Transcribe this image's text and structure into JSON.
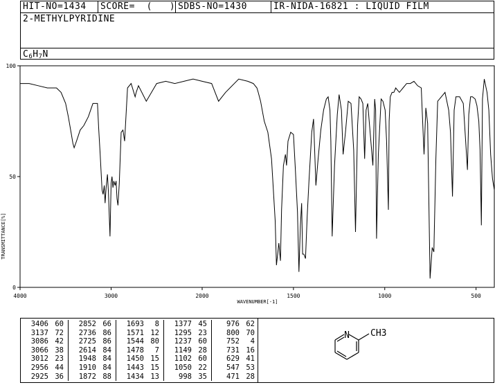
{
  "header": {
    "hit_no": "HIT-NO=1434",
    "score": "SCORE=  (   )",
    "sdbs_no": "SDBS-NO=1430",
    "source": "IR-NIDA-16821 : LIQUID FILM",
    "compound": "2-METHYLPYRIDINE",
    "formula": {
      "c": "C",
      "c_n": "6",
      "h": "H",
      "h_n": "7",
      "n": "N"
    }
  },
  "chart_data": {
    "type": "line",
    "xlabel": "WAVENUMBER[-1]",
    "ylabel": "TRANSMITTANCE[%]",
    "xlim": [
      4000,
      400
    ],
    "ylim": [
      0,
      100
    ],
    "x_ticks": [
      "4000",
      "3000",
      "2000",
      "1500",
      "1000",
      "500"
    ],
    "y_ticks": [
      "100",
      "50",
      "0"
    ],
    "grid": false,
    "series": [
      {
        "x": [
          4000,
          3900,
          3800,
          3700,
          3600,
          3550,
          3500,
          3470,
          3440,
          3420,
          3406,
          3380,
          3340,
          3300,
          3250,
          3200,
          3150,
          3137,
          3120,
          3100,
          3088,
          3075,
          3066,
          3055,
          3040,
          3030,
          3012,
          3000,
          2990,
          2980,
          2970,
          2956,
          2945,
          2935,
          2925,
          2910,
          2890,
          2870,
          2852,
          2820,
          2780,
          2736,
          2725,
          2700,
          2614,
          2500,
          2400,
          2300,
          2200,
          2100,
          2000,
          1948,
          1910,
          1872,
          1800,
          1750,
          1720,
          1700,
          1693,
          1680,
          1660,
          1640,
          1620,
          1600,
          1593,
          1580,
          1571,
          1565,
          1555,
          1544,
          1538,
          1530,
          1515,
          1500,
          1490,
          1478,
          1470,
          1462,
          1455,
          1450,
          1443,
          1434,
          1425,
          1415,
          1400,
          1390,
          1377,
          1365,
          1350,
          1335,
          1320,
          1310,
          1300,
          1295,
          1288,
          1275,
          1260,
          1250,
          1237,
          1228,
          1215,
          1200,
          1185,
          1170,
          1160,
          1149,
          1140,
          1130,
          1120,
          1110,
          1102,
          1093,
          1080,
          1065,
          1055,
          1050,
          1045,
          1035,
          1020,
          1010,
          998,
          990,
          980,
          976,
          970,
          960,
          950,
          940,
          930,
          920,
          900,
          880,
          860,
          840,
          820,
          800,
          795,
          785,
          775,
          765,
          752,
          740,
          731,
          720,
          710,
          690,
          670,
          650,
          640,
          629,
          620,
          610,
          590,
          570,
          560,
          547,
          540,
          530,
          520,
          505,
          495,
          485,
          478,
          471,
          465,
          455,
          440,
          430,
          420,
          410,
          400
        ],
        "y": [
          92,
          92,
          91,
          90,
          90,
          88,
          83,
          77,
          70,
          65,
          63,
          66,
          71,
          73,
          77,
          83,
          83,
          72,
          60,
          44,
          42,
          46,
          38,
          45,
          51,
          43,
          23,
          47,
          50,
          45,
          48,
          46,
          48,
          40,
          37,
          47,
          70,
          71,
          66,
          90,
          92,
          86,
          88,
          91,
          84,
          92,
          93,
          92,
          93,
          94,
          93,
          92,
          84,
          88,
          94,
          93,
          92,
          90,
          88,
          84,
          75,
          70,
          58,
          30,
          10,
          20,
          12,
          35,
          55,
          60,
          55,
          66,
          70,
          69,
          54,
          34,
          7,
          28,
          38,
          15,
          15,
          13,
          32,
          48,
          70,
          76,
          46,
          58,
          71,
          80,
          85,
          86,
          80,
          66,
          23,
          55,
          78,
          87,
          80,
          60,
          70,
          84,
          83,
          62,
          25,
          73,
          86,
          85,
          83,
          58,
          80,
          83,
          70,
          55,
          85,
          80,
          22,
          60,
          85,
          84,
          80,
          66,
          35,
          75,
          86,
          88,
          88,
          90,
          89,
          88,
          90,
          92,
          92,
          93,
          91,
          90,
          80,
          60,
          81,
          74,
          4,
          18,
          16,
          58,
          84,
          86,
          88,
          80,
          70,
          41,
          80,
          86,
          86,
          83,
          70,
          53,
          78,
          86,
          86,
          85,
          82,
          75,
          62,
          28,
          85,
          94,
          88,
          80,
          60,
          49,
          44
        ]
      }
    ]
  },
  "peaks": [
    [
      [
        "3406",
        "60"
      ],
      [
        "3137",
        "72"
      ],
      [
        "3086",
        "42"
      ],
      [
        "3066",
        "38"
      ],
      [
        "3012",
        "23"
      ],
      [
        "2956",
        "44"
      ],
      [
        "2925",
        "36"
      ]
    ],
    [
      [
        "2852",
        "66"
      ],
      [
        "2736",
        "86"
      ],
      [
        "2725",
        "86"
      ],
      [
        "2614",
        "84"
      ],
      [
        "1948",
        "84"
      ],
      [
        "1910",
        "84"
      ],
      [
        "1872",
        "88"
      ]
    ],
    [
      [
        "1693",
        "8"
      ],
      [
        "1571",
        "12"
      ],
      [
        "1544",
        "80"
      ],
      [
        "1478",
        "7"
      ],
      [
        "1450",
        "15"
      ],
      [
        "1443",
        "15"
      ],
      [
        "1434",
        "13"
      ]
    ],
    [
      [
        "1377",
        "45"
      ],
      [
        "1295",
        "23"
      ],
      [
        "1237",
        "60"
      ],
      [
        "1149",
        "28"
      ],
      [
        "1102",
        "60"
      ],
      [
        "1050",
        "22"
      ],
      [
        "998",
        "35"
      ]
    ],
    [
      [
        "976",
        "62"
      ],
      [
        "800",
        "70"
      ],
      [
        "752",
        "4"
      ],
      [
        "731",
        "16"
      ],
      [
        "629",
        "41"
      ],
      [
        "547",
        "53"
      ],
      [
        "471",
        "28"
      ]
    ]
  ],
  "structure": {
    "ring_atom": "N",
    "substituent": "CH3"
  }
}
